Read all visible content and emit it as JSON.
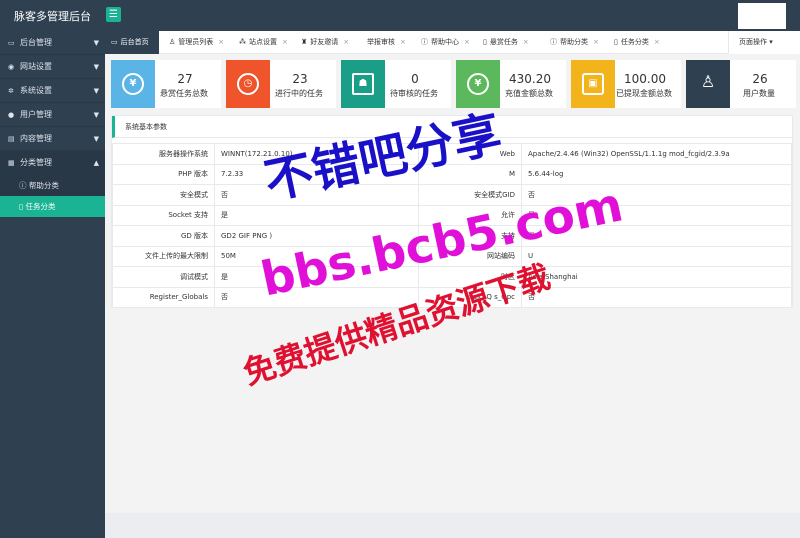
{
  "header": {
    "title": "脉客多管理后台",
    "toggle_icon": "hamburger-icon"
  },
  "sidebar": {
    "items": [
      {
        "label": "后台管理",
        "icon": "desktop-icon"
      },
      {
        "label": "网站设置",
        "icon": "globe-icon"
      },
      {
        "label": "系统设置",
        "icon": "gear-icon"
      },
      {
        "label": "用户管理",
        "icon": "user-icon"
      },
      {
        "label": "内容管理",
        "icon": "folder-icon"
      },
      {
        "label": "分类管理",
        "icon": "grid-icon"
      }
    ],
    "subitems": [
      {
        "label": "帮助分类",
        "icon": "help-icon"
      },
      {
        "label": "任务分类",
        "icon": "doc-icon"
      }
    ]
  },
  "tabs": [
    {
      "label": "后台首页"
    },
    {
      "label": "管理员列表"
    },
    {
      "label": "站点设置"
    },
    {
      "label": "好友邀请"
    },
    {
      "label": "举报审核"
    },
    {
      "label": "帮助中心"
    },
    {
      "label": "悬赏任务"
    },
    {
      "label": "帮助分类"
    },
    {
      "label": "任务分类"
    }
  ],
  "tab_actions": {
    "label": "页面操作"
  },
  "stats": [
    {
      "value": "27",
      "label": "悬赏任务总数",
      "color": "#5ab4e5",
      "icon": "yen-icon"
    },
    {
      "value": "23",
      "label": "进行中的任务",
      "color": "#f0542b",
      "icon": "clock-icon"
    },
    {
      "value": "0",
      "label": "待审核的任务",
      "color": "#1a9e87",
      "icon": "person-icon"
    },
    {
      "value": "430.20",
      "label": "充值金额总数",
      "color": "#5cb85c",
      "icon": "yen-icon"
    },
    {
      "value": "100.00",
      "label": "已提现金额总数",
      "color": "#f3b31a",
      "icon": "wallet-icon"
    },
    {
      "value": "26",
      "label": "用户数量",
      "color": "#2f4050",
      "icon": "user-icon"
    }
  ],
  "panel": {
    "title": "系统基本参数"
  },
  "params": [
    {
      "k1": "服务器操作系统",
      "v1": "WINNT(172.21.0.10)",
      "k2": "Web",
      "v2": "Apache/2.4.46 (Win32) OpenSSL/1.1.1g mod_fcgid/2.3.9a"
    },
    {
      "k1": "PHP 版本",
      "v1": "7.2.33",
      "k2": "M",
      "v2": "5.6.44-log"
    },
    {
      "k1": "安全模式",
      "v1": "否",
      "k2": "安全模式GID",
      "v2": "否"
    },
    {
      "k1": "Socket 支持",
      "v1": "是",
      "k2": "允许",
      "v2": "是"
    },
    {
      "k1": "GD 版本",
      "v1": "GD2 GIF PNG )",
      "k2": "支持",
      "v2": "是"
    },
    {
      "k1": "文件上传的最大限制",
      "v1": "50M",
      "k2": "网站编码",
      "v2": "U"
    },
    {
      "k1": "调试模式",
      "v1": "是",
      "k2": "时区",
      "v2": "Asia/Shanghai"
    },
    {
      "k1": "Register_Globals",
      "v1": "否",
      "k2": "agic_Q s_Gpc",
      "v2": "否"
    }
  ],
  "watermark": {
    "line1": "不错吧分享",
    "line2": "bbs.bcb5.com",
    "line3": "免费提供精品资源下载"
  }
}
